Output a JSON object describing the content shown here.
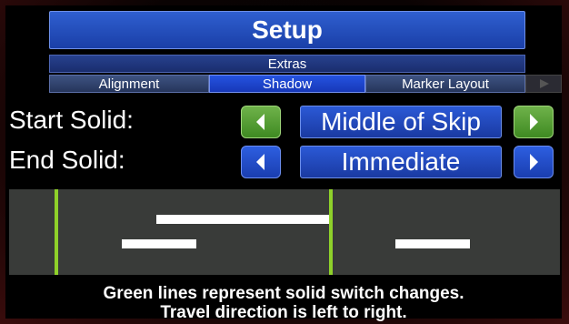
{
  "title": "Setup",
  "subtab": "Extras",
  "tabs": [
    {
      "label": "Alignment",
      "active": false
    },
    {
      "label": "Shadow",
      "active": true
    },
    {
      "label": "Marker Layout",
      "active": false
    }
  ],
  "start_solid": {
    "label": "Start Solid:",
    "value": "Middle of Skip",
    "button_color": "green",
    "left_icon": "triangle-left",
    "right_icon": "triangle-right"
  },
  "end_solid": {
    "label": "End Solid:",
    "value": "Immediate",
    "button_color": "blue",
    "left_icon": "triangle-left",
    "right_icon": "triangle-right"
  },
  "preview": {
    "background_color": "#393b39",
    "green_line_color": "#8fd12a",
    "segment_color": "#ffffff"
  },
  "caption": {
    "line1": "Green lines represent solid switch changes.",
    "line2": "Travel direction is left to right."
  },
  "colors": {
    "accent_blue": "#2553e0",
    "button_green": "#4f9a2e"
  }
}
